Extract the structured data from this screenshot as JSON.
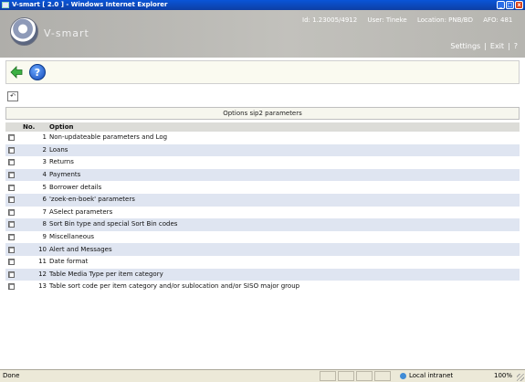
{
  "window": {
    "title": "V-smart [ 2.0 ] - Windows Internet Explorer"
  },
  "header": {
    "app_name": "V-smart",
    "id": "Id: 1.23005/4912",
    "user": "User: Tineke",
    "location": "Location: PNB/BD",
    "afo": "AFO: 481",
    "menu": {
      "settings": "Settings",
      "sep1": "|",
      "exit": "Exit",
      "sep2": "|",
      "help": "?"
    }
  },
  "toolbar": {
    "back_icon": "arrow-left-icon",
    "help_icon": "question-mark-icon",
    "help_glyph": "?"
  },
  "undo": {
    "icon": "undo-icon",
    "glyph": "↶"
  },
  "table": {
    "caption": "Options sip2 parameters",
    "columns": {
      "no": "No.",
      "option": "Option"
    },
    "rows": [
      {
        "no": "1",
        "option": "Non-updateable parameters and Log"
      },
      {
        "no": "2",
        "option": "Loans"
      },
      {
        "no": "3",
        "option": "Returns"
      },
      {
        "no": "4",
        "option": "Payments"
      },
      {
        "no": "5",
        "option": "Borrower details"
      },
      {
        "no": "6",
        "option": "'zoek-en-boek' parameters"
      },
      {
        "no": "7",
        "option": "ASelect parameters"
      },
      {
        "no": "8",
        "option": "Sort Bin type and special Sort Bin codes"
      },
      {
        "no": "9",
        "option": "Miscellaneous"
      },
      {
        "no": "10",
        "option": "Alert and Messages"
      },
      {
        "no": "11",
        "option": "Date format"
      },
      {
        "no": "12",
        "option": "Table Media Type per item category"
      },
      {
        "no": "13",
        "option": "Table sort code per item category and/or sublocation and/or SISO major group"
      }
    ]
  },
  "statusbar": {
    "done": "Done",
    "zone": "Local intranet",
    "zoom": "100%"
  },
  "colors": {
    "title_blue": "#0a55d8",
    "row_alt": "#dfe5f1",
    "header_gray": "#b6b5b0"
  }
}
